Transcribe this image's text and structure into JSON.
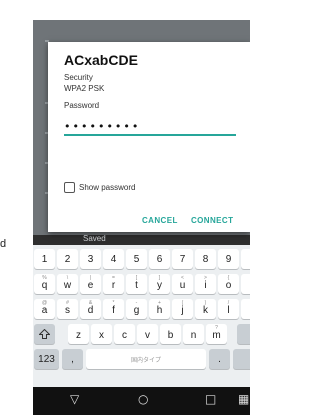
{
  "outside_text": "d",
  "background": {
    "saved_label": "Saved"
  },
  "dialog": {
    "ssid": "ACxabCDE",
    "security_label": "Security",
    "security_value": "WPA2 PSK",
    "password_label": "Password",
    "password_value": "•••••••••",
    "show_password_label": "Show password",
    "cancel_label": "CANCEL",
    "connect_label": "CONNECT",
    "accent_color": "#26a69a"
  },
  "keyboard": {
    "number_row": [
      "1",
      "2",
      "3",
      "4",
      "5",
      "6",
      "7",
      "8",
      "9"
    ],
    "row1": [
      "q",
      "w",
      "e",
      "r",
      "t",
      "y",
      "u",
      "i",
      "o"
    ],
    "row1_hints": [
      "%",
      "\\",
      "|",
      "=",
      "[",
      "]",
      "<",
      ">",
      "{"
    ],
    "row2": [
      "a",
      "s",
      "d",
      "f",
      "g",
      "h",
      "j",
      "k",
      "l"
    ],
    "row2_hints": [
      "@",
      "#",
      "&",
      "*",
      "-",
      "+",
      "(",
      ")",
      "/"
    ],
    "row3": [
      "z",
      "x",
      "c",
      "v",
      "b",
      "n",
      "m"
    ],
    "row3_hints": [
      "",
      "",
      "",
      "",
      "",
      "",
      "?"
    ],
    "symbols_label": "123",
    "comma_label": ",",
    "space_label": "国内タイプ",
    "shift_icon": "shift-icon",
    "period_label": "."
  },
  "navbar": {
    "back_icon": "back-icon",
    "home_icon": "home-icon",
    "recents_icon": "recents-icon",
    "keyboard_switch_icon": "keyboard-switch-icon"
  }
}
